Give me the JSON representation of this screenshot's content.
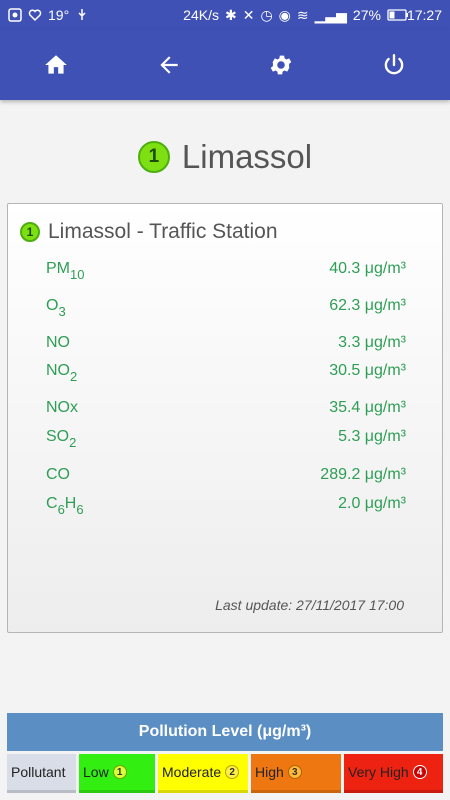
{
  "status_bar": {
    "temperature": "19°",
    "network_speed": "24K/s",
    "battery": "27%",
    "time": "17:27"
  },
  "toolbar": {
    "icons": [
      "home-icon",
      "back-arrow-icon",
      "settings-gear-icon",
      "power-icon"
    ]
  },
  "city": {
    "level": "1",
    "name": "Limassol"
  },
  "station": {
    "level": "1",
    "name": "Limassol - Traffic Station",
    "pollutants": [
      {
        "name": "PM",
        "sub": "10",
        "value": "40.3 μg/m³"
      },
      {
        "name": "O",
        "sub": "3",
        "value": "62.3 μg/m³"
      },
      {
        "name": "NO",
        "sub": "",
        "value": "3.3 μg/m³"
      },
      {
        "name": "NO",
        "sub": "2",
        "value": "30.5 μg/m³"
      },
      {
        "name": "NOx",
        "sub": "",
        "value": "35.4 μg/m³"
      },
      {
        "name": "SO",
        "sub": "2",
        "value": "5.3 μg/m³"
      },
      {
        "name": "CO",
        "sub": "",
        "value": "289.2 μg/m³"
      },
      {
        "name": "C6H6",
        "sub": "",
        "value": "2.0 μg/m³"
      }
    ],
    "last_update": "Last update: 27/11/2017 17:00"
  },
  "legend": {
    "title": "Pollution Level (μg/m³)",
    "cells": [
      {
        "label": "Pollutant",
        "badge": "",
        "color": "#d9dde8"
      },
      {
        "label": "Low",
        "badge": "1",
        "color": "#33ee11"
      },
      {
        "label": "Moderate",
        "badge": "2",
        "color": "#ffff00"
      },
      {
        "label": "High",
        "badge": "3",
        "color": "#ee7711"
      },
      {
        "label": "Very High",
        "badge": "4",
        "color": "#ee2211"
      }
    ]
  },
  "colors": {
    "primary": "#3f51b5",
    "value_green": "#2e9e55",
    "level1_green": "#7ee012",
    "legend_header": "#5b8ec3"
  }
}
